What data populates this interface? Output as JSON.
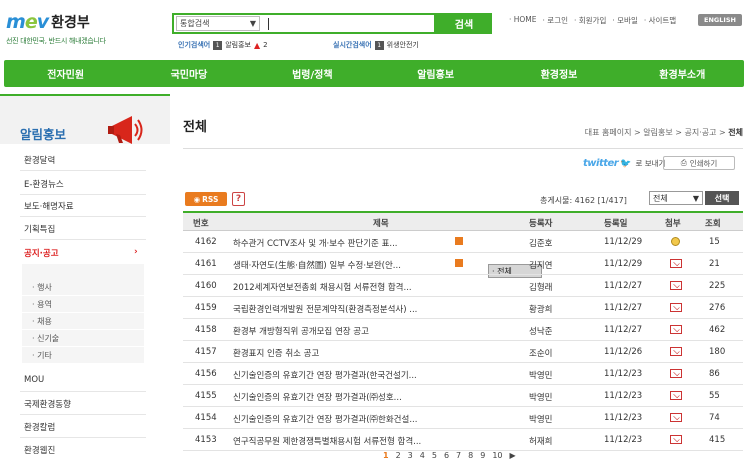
{
  "header": {
    "logo_text": "mev",
    "logo_name": "환경부",
    "slogan": "선진 대한민국, 반드시 해내겠습니다",
    "search_scope": "통합검색",
    "search_button": "검색",
    "popular_label": "인기검색어",
    "popular_rank": "1",
    "popular_term": "알림홍보",
    "popular_change": "2",
    "realtime_label": "실시간검색어",
    "realtime_rank": "1",
    "realtime_term": "위생안전기",
    "top_links": [
      "· HOME",
      "· 로그인",
      "· 회원가입",
      "· 모바일",
      "· 사이트맵"
    ],
    "english": "ENGLISH"
  },
  "gnb": [
    "전자민원",
    "국민마당",
    "법령/정책",
    "알림홍보",
    "환경정보",
    "환경부소개"
  ],
  "sidebar": {
    "title": "알림홍보",
    "items": [
      "환경달력",
      "E-환경뉴스",
      "보도·해명자료",
      "기획특집",
      "공지·공고",
      "MOU",
      "국제환경동향",
      "환경칼럼",
      "환경웹진"
    ],
    "sub_items": [
      "· 전체",
      "· 행사",
      "· 용역",
      "· 채용",
      "· 신기술",
      "· 기타"
    ]
  },
  "main": {
    "title": "전체",
    "breadcrumb": [
      "대표 홈페이지",
      "알림홍보",
      "공지·공고",
      "전체"
    ],
    "twitter": "twitter",
    "send": "로 보내기",
    "print": "인쇄하기",
    "rss": "RSS",
    "help": "?",
    "count_text": "총게시물: 4162 [1/417]",
    "select_value": "전체",
    "select_button": "선택",
    "columns": [
      "번호",
      "제목",
      "등록자",
      "등록일",
      "첨부",
      "조회"
    ],
    "rows": [
      {
        "no": "4162",
        "title": "하수관거 CCTV조사 및 개·보수 판단기준 표...",
        "writer": "김준호",
        "date": "11/12/29",
        "views": "15"
      },
      {
        "no": "4161",
        "title": "생태·자연도(生態·自然圖) 일부 수정·보완(안...",
        "writer": "김지연",
        "date": "11/12/29",
        "views": "21"
      },
      {
        "no": "4160",
        "title": "2012세계자연보전총회 채용시험 서류전형 합격...",
        "writer": "김형래",
        "date": "11/12/27",
        "views": "225"
      },
      {
        "no": "4159",
        "title": "국립환경인력개발원 전문계약직(환경측정분석사) ...",
        "writer": "황광희",
        "date": "11/12/27",
        "views": "276"
      },
      {
        "no": "4158",
        "title": "환경부 개방형직위 공개모집 연장 공고",
        "writer": "성낙준",
        "date": "11/12/27",
        "views": "462"
      },
      {
        "no": "4157",
        "title": "환경표지 인증 취소 공고",
        "writer": "조순이",
        "date": "11/12/26",
        "views": "180"
      },
      {
        "no": "4156",
        "title": "신기술인증의 유효기간 연장 평가결과(한국건설기...",
        "writer": "박영민",
        "date": "11/12/23",
        "views": "86"
      },
      {
        "no": "4155",
        "title": "신기술인증의 유효기간 연장 평가결과(㈜성호...",
        "writer": "박영민",
        "date": "11/12/23",
        "views": "55"
      },
      {
        "no": "4154",
        "title": "신기술인증의 유효기간 연장 평가결과(㈜한화건설...",
        "writer": "박영민",
        "date": "11/12/23",
        "views": "74"
      },
      {
        "no": "4153",
        "title": "연구직공무원 제한경쟁특별채용시험 서류전형 합격...",
        "writer": "허재희",
        "date": "11/12/23",
        "views": "415"
      }
    ],
    "pages": [
      "1",
      "2",
      "3",
      "4",
      "5",
      "6",
      "7",
      "8",
      "9",
      "10",
      "▶"
    ]
  },
  "colors": {
    "brand_green": "#3fae2a",
    "accent_orange": "#e97b1f",
    "link_blue": "#2b6fb0"
  }
}
